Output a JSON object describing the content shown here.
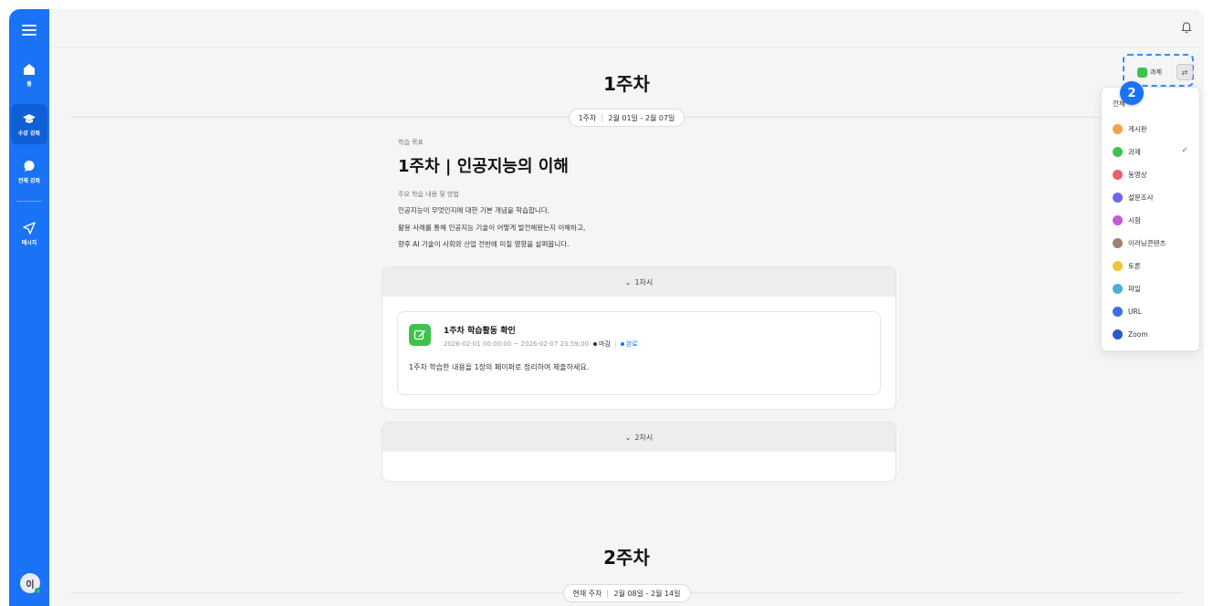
{
  "sidebar": {
    "items": [
      {
        "label": "홈",
        "icon": "home-icon"
      },
      {
        "label": "수강 강좌",
        "icon": "graduation-cap-icon"
      },
      {
        "label": "전체 강좌",
        "icon": "chat-bubble-icon"
      },
      {
        "label": "메시지",
        "icon": "send-icon"
      }
    ],
    "avatar": "이"
  },
  "week1": {
    "title": "1주차",
    "pill_label": "1주차",
    "pill_dates": "2월 01일 - 2월 07일",
    "goal_label": "학습 목표",
    "goal_title": "1주차 | 인공지능의 이해",
    "desc_label": "주요 학습 내용 및 방법",
    "desc_lines": [
      "인공지능이 무엇인지에 대한 기본 개념을 학습합니다.",
      "활용 사례를 통해 인공지능 기술이 어떻게 발전해왔는지 이해하고,",
      "향후 AI 기술이 사회와 산업 전반에 미칠 영향을 살펴봅니다."
    ],
    "sessions": [
      {
        "label": "1차시",
        "activity": {
          "title": "1주차 학습활동 확인",
          "period": "2026-02-01 00:00:00 ~ 2026-02-07 23:59:00",
          "tag1": "마감",
          "tag2": "완료",
          "description": "1주차 학습한 내용을 1장의 페이퍼로 정리하여 제출하세요."
        }
      },
      {
        "label": "2차시"
      }
    ]
  },
  "week2": {
    "title": "2주차",
    "pill_label": "현재 주차",
    "pill_dates": "2월 08일 - 2월 14일"
  },
  "filter": {
    "label": "과제",
    "swap_glyph": "⇄",
    "step_badge": "2"
  },
  "dropdown": {
    "header": "전체",
    "items": [
      {
        "label": "게시판",
        "color": "#f3a14a"
      },
      {
        "label": "과제",
        "color": "#3fc24b",
        "selected": true
      },
      {
        "label": "동영상",
        "color": "#f0606c"
      },
      {
        "label": "설문조사",
        "color": "#6a6ae8"
      },
      {
        "label": "시험",
        "color": "#c45ad8"
      },
      {
        "label": "이러닝콘텐츠",
        "color": "#a0826a"
      },
      {
        "label": "토론",
        "color": "#f2c237"
      },
      {
        "label": "파일",
        "color": "#4aaed8"
      },
      {
        "label": "URL",
        "color": "#3c6ee0"
      },
      {
        "label": "Zoom",
        "color": "#2a5ad0"
      }
    ],
    "check_glyph": "✓"
  },
  "colors": {
    "sidebar": "#1a73f5",
    "accent": "#1a73f5",
    "assignment_green": "#3fc24b"
  }
}
